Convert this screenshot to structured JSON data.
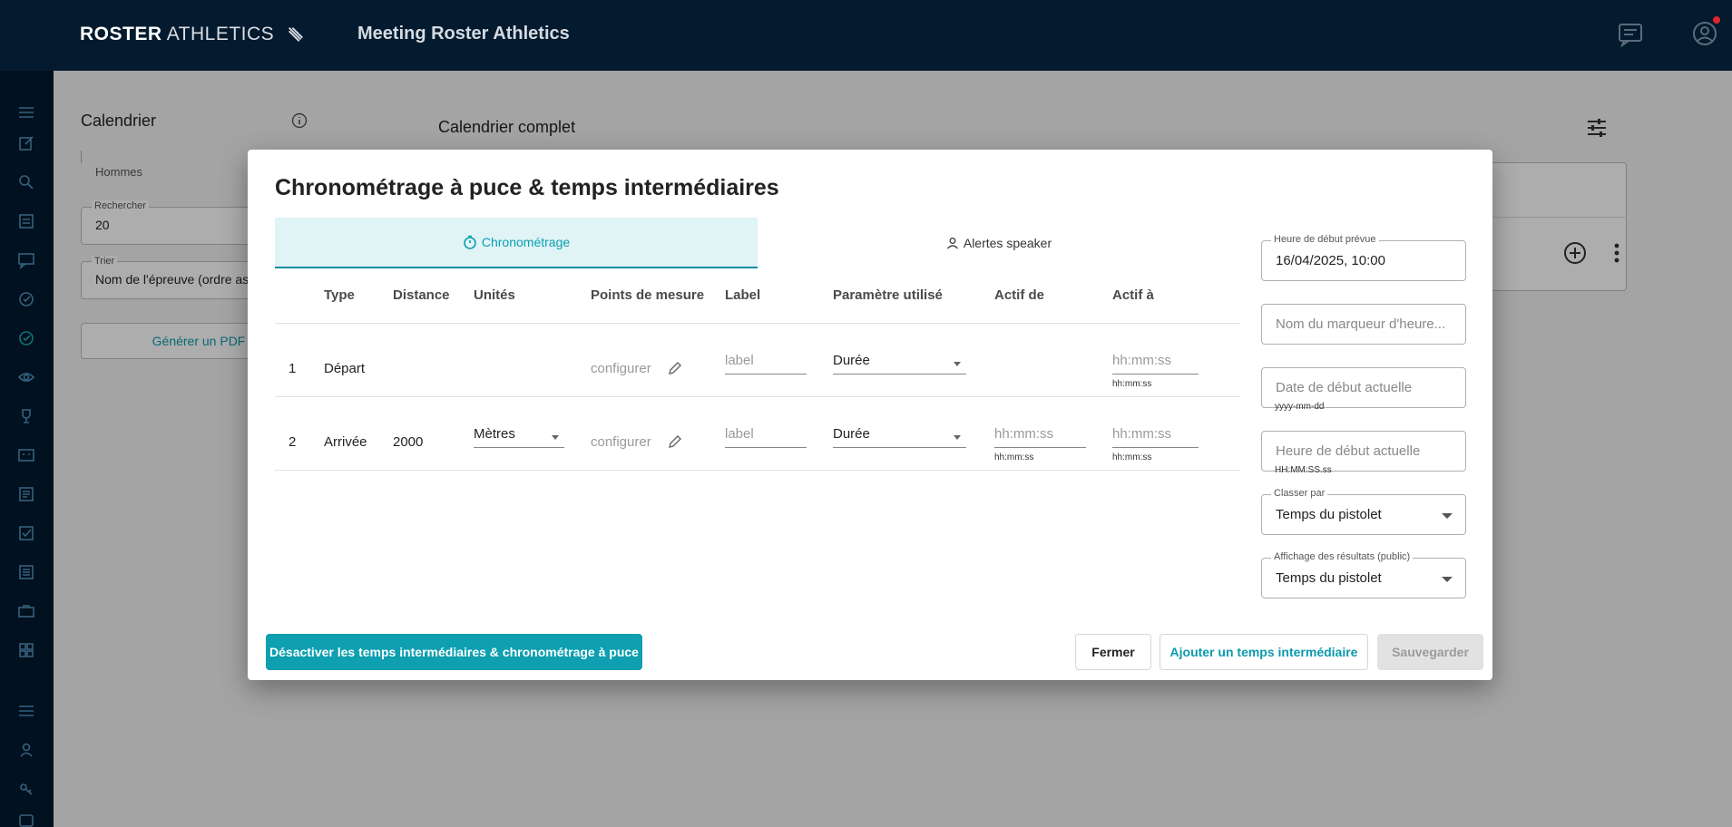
{
  "header": {
    "logo_bold": "ROSTER",
    "logo_light": "ATHLETICS",
    "app_title": "Meeting Roster Athletics"
  },
  "background": {
    "left_title": "Calendrier",
    "main_title": "Calendrier complet",
    "gender_filter": "Hommes",
    "search_label": "Rechercher",
    "search_value": "20",
    "sort_label": "Trier",
    "sort_value": "Nom de l'épreuve (ordre asc",
    "pdf_button": "Générer un PDF"
  },
  "modal": {
    "title": "Chronométrage à puce & temps intermédiaires",
    "tabs": [
      {
        "label": "Chronométrage",
        "icon": "timer-icon",
        "active": true
      },
      {
        "label": "Alertes speaker",
        "icon": "person-icon",
        "active": false
      }
    ],
    "columns": [
      "Type",
      "Distance",
      "Unités",
      "Points de mesure",
      "Label",
      "Paramètre utilisé",
      "Actif de",
      "Actif à"
    ],
    "rows": [
      {
        "index": "1",
        "type": "Départ",
        "distance": "",
        "unit": "",
        "measure_points": "configurer",
        "label_placeholder": "label",
        "parameter": "Durée",
        "active_from": "",
        "active_from_helper": "",
        "active_to_placeholder": "hh:mm:ss",
        "active_to_helper": "hh:mm:ss"
      },
      {
        "index": "2",
        "type": "Arrivée",
        "distance": "2000",
        "unit": "Mètres",
        "measure_points": "configurer",
        "label_placeholder": "label",
        "parameter": "Durée",
        "active_from": "hh:mm:ss",
        "active_from_helper": "hh:mm:ss",
        "active_to_placeholder": "hh:mm:ss",
        "active_to_helper": "hh:mm:ss"
      }
    ],
    "right_panel": {
      "planned_start_label": "Heure de début prévue",
      "planned_start_value": "16/04/2025, 10:00",
      "marker_placeholder": "Nom du marqueur d'heure...",
      "actual_date_placeholder": "Date de début actuelle",
      "actual_date_helper": "yyyy-mm-dd",
      "actual_time_placeholder": "Heure de début actuelle",
      "actual_time_helper": "HH:MM:SS.ss",
      "rank_label": "Classer par",
      "rank_value": "Temps du pistolet",
      "results_label": "Affichage des résultats (public)",
      "results_value": "Temps du pistolet"
    },
    "buttons": {
      "disable": "Désactiver les temps intermédiaires & chronométrage à puce",
      "close": "Fermer",
      "add_split": "Ajouter un temps intermédiaire",
      "save": "Sauvegarder"
    }
  },
  "colors": {
    "navy": "#041a2e",
    "teal": "#0e9fb0",
    "tab_bg": "#e0f3f5",
    "notification": "#e0262c"
  }
}
